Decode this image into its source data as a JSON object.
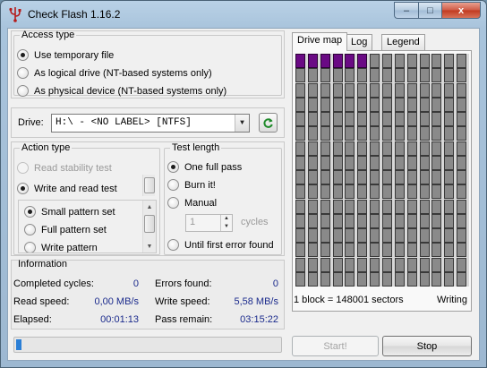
{
  "window": {
    "title": "Check Flash 1.16.2",
    "controls": {
      "minimize": "–",
      "maximize": "□",
      "close": "x"
    }
  },
  "access_type": {
    "legend": "Access type",
    "options": [
      {
        "label": "Use temporary file",
        "selected": true
      },
      {
        "label": "As logical drive (NT-based systems only)",
        "selected": false
      },
      {
        "label": "As physical device (NT-based systems only)",
        "selected": false
      }
    ]
  },
  "drive": {
    "label": "Drive:",
    "value": "H:\\ - <NO LABEL> [NTFS]"
  },
  "action_type": {
    "legend": "Action type",
    "options": [
      {
        "label": "Read stability test",
        "selected": false,
        "disabled": true
      },
      {
        "label": "Write and read test",
        "selected": true,
        "disabled": false
      }
    ],
    "patterns": [
      {
        "label": "Small pattern set",
        "selected": true
      },
      {
        "label": "Full pattern set",
        "selected": false
      },
      {
        "label": "Write pattern",
        "selected": false
      }
    ]
  },
  "test_length": {
    "legend": "Test length",
    "options": [
      {
        "label": "One full pass",
        "selected": true
      },
      {
        "label": "Burn it!",
        "selected": false
      },
      {
        "label": "Manual",
        "selected": false
      }
    ],
    "cycles_value": "1",
    "cycles_label": "cycles",
    "until_error": {
      "label": "Until first error found",
      "selected": false
    }
  },
  "information": {
    "legend": "Information",
    "completed_cycles_label": "Completed cycles:",
    "completed_cycles": "0",
    "errors_found_label": "Errors found:",
    "errors_found": "0",
    "read_speed_label": "Read speed:",
    "read_speed": "0,00 MB/s",
    "write_speed_label": "Write speed:",
    "write_speed": "5,58 MB/s",
    "elapsed_label": "Elapsed:",
    "elapsed": "00:01:13",
    "pass_remain_label": "Pass remain:",
    "pass_remain": "03:15:22"
  },
  "tabs": [
    "Drive map",
    "Log",
    "Legend"
  ],
  "drive_map": {
    "columns": 14,
    "rows": 16,
    "blocks_done": 6,
    "done_color": "#6a0a84",
    "pending_color": "#8a8a8a",
    "block_info": "1 block = 148001 sectors",
    "status": "Writing"
  },
  "buttons": {
    "start": "Start!",
    "stop": "Stop"
  },
  "progress": {
    "fraction": 0.02,
    "color": "#2b7fd6"
  }
}
